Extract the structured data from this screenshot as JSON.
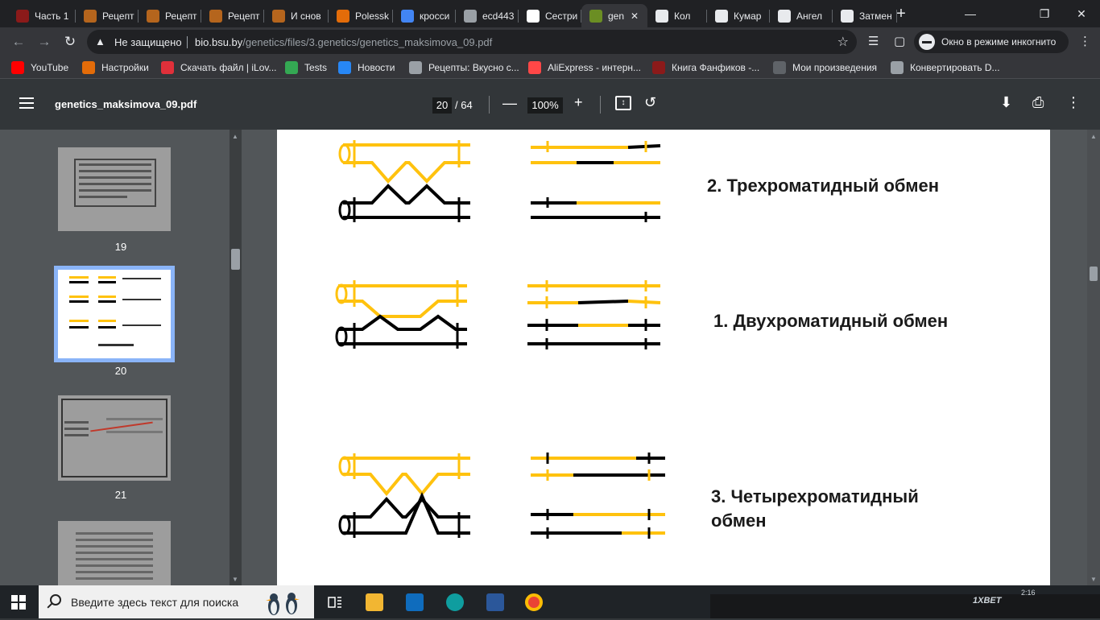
{
  "browser": {
    "tabs": [
      {
        "title": "Часть 1",
        "color": "#8b1a1a"
      },
      {
        "title": "Рецепт",
        "color": "#b5651d"
      },
      {
        "title": "Рецепт",
        "color": "#b5651d"
      },
      {
        "title": "Рецепт",
        "color": "#b5651d"
      },
      {
        "title": "И снов",
        "color": "#b5651d"
      },
      {
        "title": "Polessk",
        "color": "#e36c09"
      },
      {
        "title": "кросси",
        "color": "#4285f4"
      },
      {
        "title": "ecd443",
        "color": "#9aa0a6"
      },
      {
        "title": "Сестри",
        "color": "#ffffff"
      },
      {
        "title": "gen",
        "color": "#6b8e23",
        "active": true
      },
      {
        "title": "Кол",
        "color": "#e8eaed"
      },
      {
        "title": "Кумар",
        "color": "#e8eaed"
      },
      {
        "title": "Ангел",
        "color": "#e8eaed"
      },
      {
        "title": "Затмен",
        "color": "#e8eaed"
      }
    ],
    "url_security": "Не защищено",
    "url_host": "bio.bsu.by",
    "url_path": "/genetics/files/3.genetics/genetics_maksimova_09.pdf",
    "incognito_label": "Окно в режиме инкогнито",
    "bookmarks": [
      {
        "label": "YouTube",
        "color": "#ff0000"
      },
      {
        "label": "Настройки",
        "color": "#e36c09"
      },
      {
        "label": "Скачать файл | iLov...",
        "color": "#e0303a"
      },
      {
        "label": "Tests",
        "color": "#34a853"
      },
      {
        "label": "Новости",
        "color": "#2787f5"
      },
      {
        "label": "Рецепты: Вкусно с...",
        "color": "#9aa0a6"
      },
      {
        "label": "AliExpress - интерн...",
        "color": "#ff4747"
      },
      {
        "label": "Книга Фанфиков -...",
        "color": "#8b1a1a"
      },
      {
        "label": "Мои произведения",
        "color": "#5f6368"
      },
      {
        "label": "Конвертировать D...",
        "color": "#9aa0a6"
      }
    ]
  },
  "pdf": {
    "filename": "genetics_maksimova_09.pdf",
    "current_page": "20",
    "total_pages": "/ 64",
    "zoom": "100%",
    "thumbnails": [
      {
        "page": "19"
      },
      {
        "page": "20",
        "active": true
      },
      {
        "page": "21"
      },
      {
        "page": ""
      }
    ],
    "content": {
      "label_three": "2. Трехроматидный обмен",
      "label_two": "1. Двухроматидный обмен",
      "label_four_line1": "3. Четырехроматидный",
      "label_four_line2": "обмен"
    },
    "colors": {
      "yellow": "#ffc20e",
      "black": "#000000"
    }
  },
  "taskbar": {
    "search_placeholder": "Введите здесь текст для поиска",
    "video_brand": "1XBET",
    "clock": "2:16"
  }
}
